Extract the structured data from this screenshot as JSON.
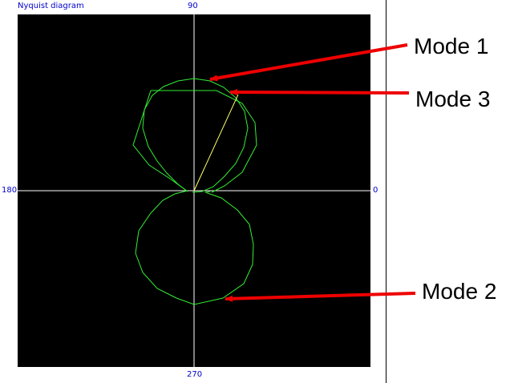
{
  "window": {
    "title": "Nyquist diagram"
  },
  "axes": {
    "top_label": "90",
    "left_label": "180",
    "right_label": "0",
    "bottom_label": "270"
  },
  "annotations": [
    {
      "label": "Mode 1"
    },
    {
      "label": "Mode 3"
    },
    {
      "label": "Mode 2"
    }
  ],
  "colors": {
    "plot_background": "#000000",
    "axis_lines": "#ffffff",
    "curve": "#33ee33",
    "indicator": "#ffff66",
    "arrow": "#ee0000",
    "angle_labels": "#0000cc"
  }
}
